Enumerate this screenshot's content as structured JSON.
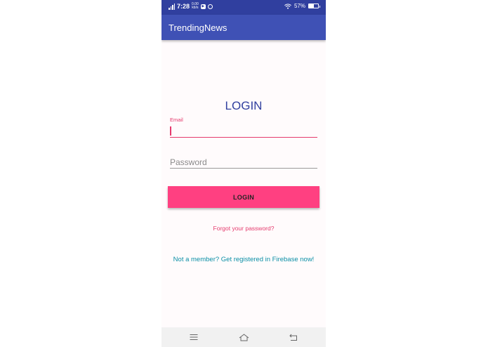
{
  "status_bar": {
    "time": "7:28",
    "network_speed_top": "0.00",
    "network_speed_bottom": "kb/s",
    "battery_percent": "57%",
    "battery_level": 0.57
  },
  "app_bar": {
    "title": "TrendingNews"
  },
  "login_form": {
    "title": "LOGIN",
    "email_label": "Email",
    "email_value": "",
    "password_placeholder": "Password",
    "login_button_label": "LOGIN",
    "forgot_password_link": "Forgot your password?",
    "register_link": "Not a member? Get registered in Firebase now!"
  },
  "nav_bar": {
    "icons": [
      "menu-icon",
      "home-icon",
      "back-icon"
    ]
  },
  "colors": {
    "status_bar": "#303f9f",
    "app_bar": "#3f51b5",
    "accent": "#ff4081",
    "link_teal": "#0b8fa6"
  }
}
